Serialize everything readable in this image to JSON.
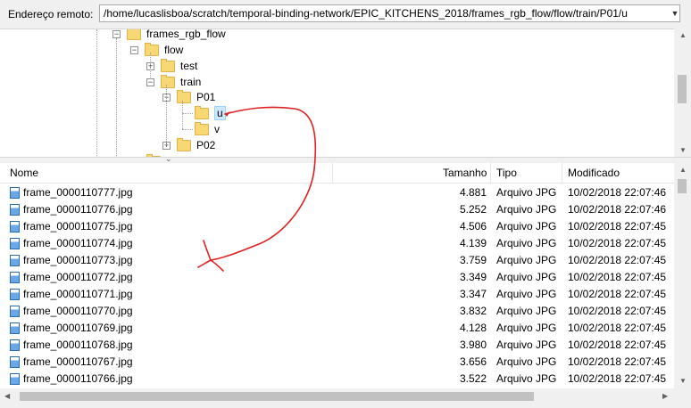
{
  "address_bar": {
    "label": "Endereço remoto:",
    "path": "/home/lucaslisboa/scratch/temporal-binding-network/EPIC_KITCHENS_2018/frames_rgb_flow/flow/train/P01/u"
  },
  "tree": {
    "nodes": [
      {
        "label": "frames_rgb_flow",
        "expander": "⊟"
      },
      {
        "label": "flow",
        "expander": "⊟"
      },
      {
        "label": "test",
        "expander": "⊞"
      },
      {
        "label": "train",
        "expander": "⊟"
      },
      {
        "label": "P01",
        "expander": "⊟"
      },
      {
        "label": "u",
        "expander": ""
      },
      {
        "label": "v",
        "expander": ""
      },
      {
        "label": "P02",
        "expander": "⊞"
      }
    ]
  },
  "list": {
    "columns": {
      "name": "Nome",
      "size": "Tamanho",
      "type": "Tipo",
      "modified": "Modificado"
    },
    "rows": [
      {
        "name": "frame_0000110777.jpg",
        "size": "4.881",
        "type": "Arquivo JPG",
        "modified": "10/02/2018 22:07:46"
      },
      {
        "name": "frame_0000110776.jpg",
        "size": "5.252",
        "type": "Arquivo JPG",
        "modified": "10/02/2018 22:07:46"
      },
      {
        "name": "frame_0000110775.jpg",
        "size": "4.506",
        "type": "Arquivo JPG",
        "modified": "10/02/2018 22:07:45"
      },
      {
        "name": "frame_0000110774.jpg",
        "size": "4.139",
        "type": "Arquivo JPG",
        "modified": "10/02/2018 22:07:45"
      },
      {
        "name": "frame_0000110773.jpg",
        "size": "3.759",
        "type": "Arquivo JPG",
        "modified": "10/02/2018 22:07:45"
      },
      {
        "name": "frame_0000110772.jpg",
        "size": "3.349",
        "type": "Arquivo JPG",
        "modified": "10/02/2018 22:07:45"
      },
      {
        "name": "frame_0000110771.jpg",
        "size": "3.347",
        "type": "Arquivo JPG",
        "modified": "10/02/2018 22:07:45"
      },
      {
        "name": "frame_0000110770.jpg",
        "size": "3.832",
        "type": "Arquivo JPG",
        "modified": "10/02/2018 22:07:45"
      },
      {
        "name": "frame_0000110769.jpg",
        "size": "4.128",
        "type": "Arquivo JPG",
        "modified": "10/02/2018 22:07:45"
      },
      {
        "name": "frame_0000110768.jpg",
        "size": "3.980",
        "type": "Arquivo JPG",
        "modified": "10/02/2018 22:07:45"
      },
      {
        "name": "frame_0000110767.jpg",
        "size": "3.656",
        "type": "Arquivo JPG",
        "modified": "10/02/2018 22:07:45"
      },
      {
        "name": "frame_0000110766.jpg",
        "size": "3.522",
        "type": "Arquivo JPG",
        "modified": "10/02/2018 22:07:45"
      }
    ]
  },
  "icons": {
    "folder": "folder-icon",
    "file": "jpg-file-icon",
    "annotation": "red-hand-drawn-arrow"
  },
  "colors": {
    "selection": "#cce8ff",
    "annotation": "#e02020",
    "folder": "#f8d775"
  }
}
